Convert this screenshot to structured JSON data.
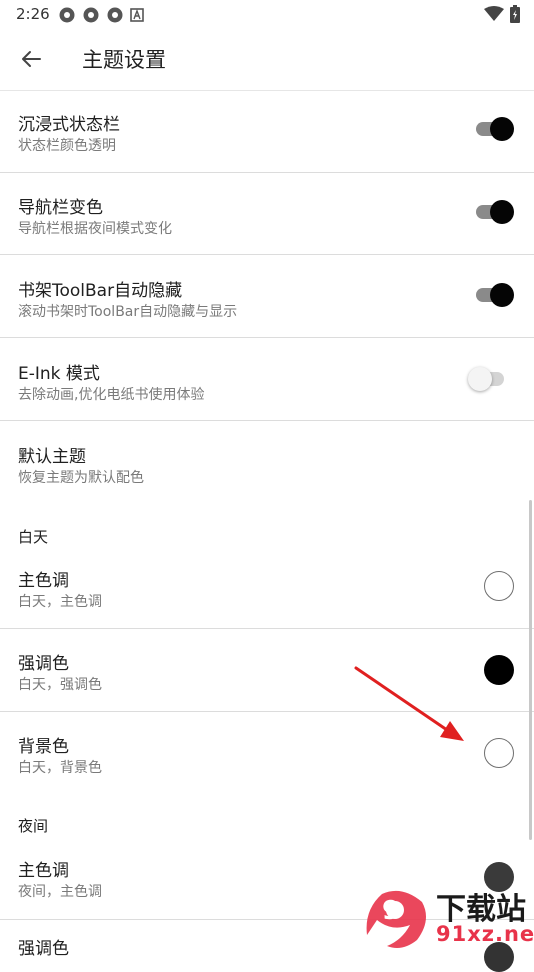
{
  "status_bar": {
    "time": "2:26"
  },
  "header": {
    "title": "主题设置"
  },
  "settings": {
    "immersive": {
      "title": "沉浸式状态栏",
      "subtitle": "状态栏颜色透明",
      "on": true
    },
    "navbar": {
      "title": "导航栏变色",
      "subtitle": "导航栏根据夜间模式变化",
      "on": true
    },
    "toolbar_hide": {
      "title": "书架ToolBar自动隐藏",
      "subtitle": "滚动书架时ToolBar自动隐藏与显示",
      "on": true
    },
    "eink": {
      "title": "E-Ink 模式",
      "subtitle": "去除动画,优化电纸书使用体验",
      "on": false
    },
    "default_theme": {
      "title": "默认主题",
      "subtitle": "恢复主题为默认配色"
    }
  },
  "day": {
    "header": "白天",
    "primary": {
      "title": "主色调",
      "subtitle": "白天，主色调",
      "color": "#ffffff"
    },
    "accent": {
      "title": "强调色",
      "subtitle": "白天，强调色",
      "color": "#000000"
    },
    "background": {
      "title": "背景色",
      "subtitle": "白天，背景色",
      "color": "#ffffff"
    }
  },
  "night": {
    "header": "夜间",
    "primary": {
      "title": "主色调",
      "subtitle": "夜间，主色调",
      "color": "#3a3a3a"
    },
    "accent": {
      "title": "强调色"
    }
  },
  "watermark": {
    "brand": "下载站",
    "domain": "91xz.net",
    "logo": "9"
  },
  "colors": {
    "arrow": "#e02020",
    "watermark_red": "#e8334a"
  }
}
